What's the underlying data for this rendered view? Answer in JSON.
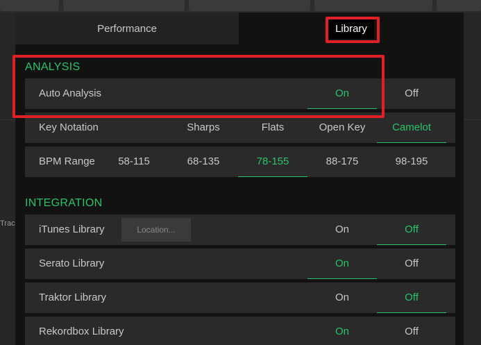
{
  "background": {
    "track_label": "Trac"
  },
  "tabs": [
    {
      "label": "Performance",
      "selected": false
    },
    {
      "label": "Library",
      "selected": true
    }
  ],
  "analysis": {
    "title": "ANALYSIS",
    "auto_analysis": {
      "label": "Auto Analysis",
      "options": [
        "On",
        "Off"
      ],
      "selected": "On"
    },
    "key_notation": {
      "label": "Key Notation",
      "options": [
        "Sharps",
        "Flats",
        "Open Key",
        "Camelot"
      ],
      "selected": "Camelot"
    },
    "bpm_range": {
      "label": "BPM Range",
      "options": [
        "58-115",
        "68-135",
        "78-155",
        "88-175",
        "98-195"
      ],
      "selected": "78-155"
    }
  },
  "integration": {
    "title": "INTEGRATION",
    "itunes": {
      "label": "iTunes Library",
      "location_label": "Location...",
      "options": [
        "On",
        "Off"
      ],
      "selected": "Off"
    },
    "serato": {
      "label": "Serato Library",
      "options": [
        "On",
        "Off"
      ],
      "selected": "On"
    },
    "traktor": {
      "label": "Traktor Library",
      "options": [
        "On",
        "Off"
      ],
      "selected": "Off"
    },
    "rekordbox": {
      "label": "Rekordbox Library",
      "options": [
        "On",
        "Off"
      ],
      "selected": "On"
    }
  },
  "colors": {
    "accent": "#27c46a",
    "highlight": "#e01f26",
    "row_bg": "#2a2a2a",
    "dialog_bg": "#121212"
  }
}
